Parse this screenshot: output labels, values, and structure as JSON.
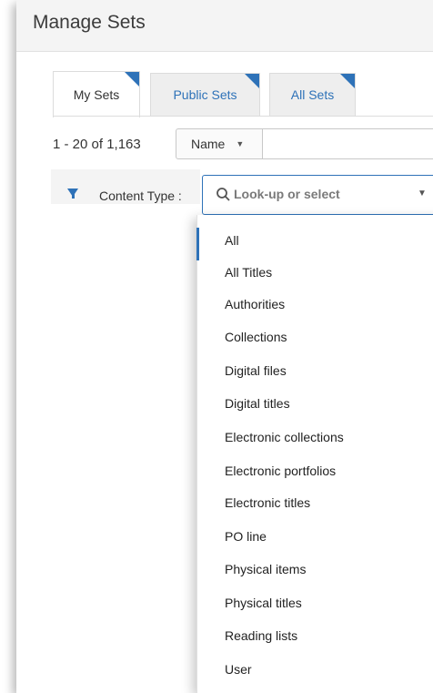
{
  "header": {
    "title": "Manage Sets"
  },
  "tabs": [
    {
      "label": "My Sets",
      "active": true
    },
    {
      "label": "Public Sets",
      "active": false
    },
    {
      "label": "All Sets",
      "active": false
    }
  ],
  "results": {
    "count_text": "1 - 20 of 1,163"
  },
  "sort": {
    "selected": "Name"
  },
  "filter": {
    "label": "Content Type :",
    "placeholder": "Look-up or select",
    "options": [
      "All",
      "All Titles",
      "Authorities",
      "Collections",
      "Digital files",
      "Digital titles",
      "Electronic collections",
      "Electronic portfolios",
      "Electronic titles",
      "PO line",
      "Physical items",
      "Physical titles",
      "Reading lists",
      "User"
    ]
  },
  "colors": {
    "accent": "#2e72b8",
    "header_bg": "#f4f4f4",
    "tab_bg": "#eeeeee"
  },
  "icons": {
    "filter": "filter-icon",
    "search": "search-icon",
    "dropdown": "chevron-down-icon"
  }
}
